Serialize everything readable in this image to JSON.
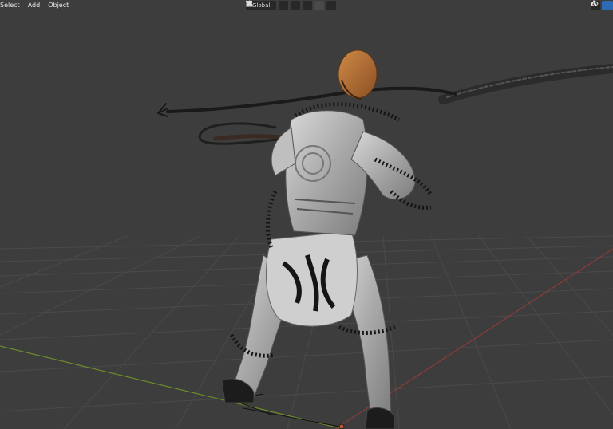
{
  "header": {
    "menus": [
      "Select",
      "Add",
      "Object"
    ],
    "transform_orientation": "Global"
  },
  "icons": {
    "orientation": "transform-orientation-icon",
    "pivot": "pivot-point-icon",
    "snap": "snap-icon",
    "snap_target": "snap-grid-icon",
    "proportional": "proportional-edit-icon",
    "falloff": "falloff-curve-icon",
    "visibility": "visibility-icon",
    "gizmo": "gizmo-icon"
  },
  "colors": {
    "viewport_bg": "#3d3d3d",
    "grid": "#4a4a4a",
    "x_axis": "#8a3b3b",
    "y_axis": "#6b8c2a"
  }
}
